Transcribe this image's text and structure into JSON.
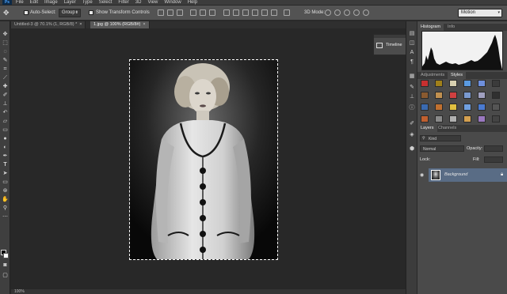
{
  "menu": {
    "logo": "Ps",
    "items": [
      "File",
      "Edit",
      "Image",
      "Layer",
      "Type",
      "Select",
      "Filter",
      "3D",
      "View",
      "Window",
      "Help"
    ]
  },
  "options": {
    "auto_select_label": "Auto-Select:",
    "auto_select_value": "Group",
    "show_transform_label": "Show Transform Controls",
    "mode_3d_label": "3D Mode:",
    "workspace_value": "Motion"
  },
  "tabs": [
    {
      "label": "Untitled-3 @ 70.1% (1, RGB/8) *",
      "close": "×"
    },
    {
      "label": "1.jpg @ 100% (RGB/8#)",
      "close": "×"
    }
  ],
  "timeline": {
    "label": "Timeline"
  },
  "histogram_panel": {
    "tabs": [
      "Histogram",
      "Info"
    ]
  },
  "adjustments_panel": {
    "tabs": [
      "Adjustments",
      "Styles"
    ]
  },
  "layers_panel": {
    "tabs": [
      "Layers",
      "Channels"
    ],
    "filter_value": "Kind",
    "blend_mode": "Normal",
    "opacity_label": "Opacity:",
    "lock_label": "Lock:",
    "fill_label": "Fill:",
    "layer_name": "Background"
  },
  "status": {
    "text": "100%"
  },
  "colors": {
    "accent_selected_layer": "#596c85",
    "chrome_dark": "#282828",
    "options_bar": "#535353"
  },
  "style_swatches": [
    "#c83030",
    "#a0801a",
    "#d8d0b0",
    "#5a9ae0",
    "#6e8fdc",
    "#3b3b3b",
    "#8a5a30",
    "#c09050",
    "#d04040",
    "#7a9ad0",
    "#a0a0c0",
    "#303030",
    "#3a6ab0",
    "#c07030",
    "#e0c040",
    "#70a0e0",
    "#4a7ad0",
    "#555555",
    "#c06030",
    "#8a8a8a",
    "#b0b0b0",
    "#d4a050",
    "#9a78c0",
    "#444444"
  ]
}
